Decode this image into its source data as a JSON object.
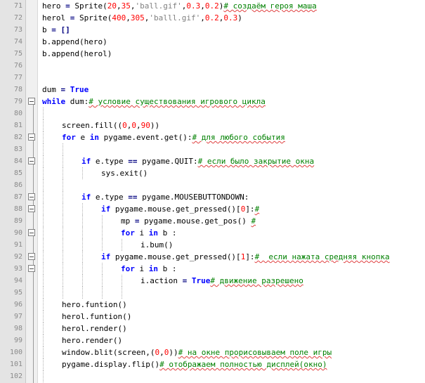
{
  "editor": {
    "lines": [
      {
        "n": "71",
        "indent": 0,
        "tokens": [
          {
            "t": "hero ",
            "c": ""
          },
          {
            "t": "=",
            "c": "op"
          },
          {
            "t": " Sprite(",
            "c": ""
          },
          {
            "t": "20",
            "c": "num"
          },
          {
            "t": ",",
            "c": ""
          },
          {
            "t": "35",
            "c": "num"
          },
          {
            "t": ",",
            "c": ""
          },
          {
            "t": "'ball.gif'",
            "c": "str"
          },
          {
            "t": ",",
            "c": ""
          },
          {
            "t": "0.3",
            "c": "num"
          },
          {
            "t": ",",
            "c": ""
          },
          {
            "t": "0.2",
            "c": "num"
          },
          {
            "t": ")",
            "c": ""
          },
          {
            "t": "# создаём героя маша",
            "c": "cm"
          }
        ]
      },
      {
        "n": "72",
        "indent": 0,
        "tokens": [
          {
            "t": "herol ",
            "c": ""
          },
          {
            "t": "=",
            "c": "op"
          },
          {
            "t": " Sprite(",
            "c": ""
          },
          {
            "t": "400",
            "c": "num"
          },
          {
            "t": ",",
            "c": ""
          },
          {
            "t": "305",
            "c": "num"
          },
          {
            "t": ",",
            "c": ""
          },
          {
            "t": "'balll.gif'",
            "c": "str"
          },
          {
            "t": ",",
            "c": ""
          },
          {
            "t": "0.2",
            "c": "num"
          },
          {
            "t": ",",
            "c": ""
          },
          {
            "t": "0.3",
            "c": "num"
          },
          {
            "t": ")",
            "c": ""
          }
        ]
      },
      {
        "n": "73",
        "indent": 0,
        "tokens": [
          {
            "t": "b ",
            "c": ""
          },
          {
            "t": "=",
            "c": "op"
          },
          {
            "t": " []",
            "c": "op"
          }
        ]
      },
      {
        "n": "74",
        "indent": 0,
        "tokens": [
          {
            "t": "b.append(hero)",
            "c": ""
          }
        ]
      },
      {
        "n": "75",
        "indent": 0,
        "tokens": [
          {
            "t": "b.append(herol)",
            "c": ""
          }
        ]
      },
      {
        "n": "76",
        "indent": 0,
        "tokens": []
      },
      {
        "n": "77",
        "indent": 0,
        "tokens": []
      },
      {
        "n": "78",
        "indent": 0,
        "tokens": [
          {
            "t": "dum ",
            "c": ""
          },
          {
            "t": "=",
            "c": "op"
          },
          {
            "t": " ",
            "c": ""
          },
          {
            "t": "True",
            "c": "kw"
          }
        ]
      },
      {
        "n": "79",
        "indent": 0,
        "fold": true,
        "tokens": [
          {
            "t": "while",
            "c": "kw"
          },
          {
            "t": " dum:",
            "c": ""
          },
          {
            "t": "# условие существования игрового цикла",
            "c": "cm"
          }
        ]
      },
      {
        "n": "80",
        "indent": 1,
        "tokens": []
      },
      {
        "n": "81",
        "indent": 1,
        "tokens": [
          {
            "t": "screen.fill((",
            "c": ""
          },
          {
            "t": "0",
            "c": "num"
          },
          {
            "t": ",",
            "c": ""
          },
          {
            "t": "0",
            "c": "num"
          },
          {
            "t": ",",
            "c": ""
          },
          {
            "t": "90",
            "c": "num"
          },
          {
            "t": "))",
            "c": ""
          }
        ]
      },
      {
        "n": "82",
        "indent": 1,
        "fold": true,
        "tokens": [
          {
            "t": "for",
            "c": "kw"
          },
          {
            "t": " e ",
            "c": ""
          },
          {
            "t": "in",
            "c": "kw"
          },
          {
            "t": " pygame.event.get():",
            "c": ""
          },
          {
            "t": "# для любого события",
            "c": "cm"
          }
        ]
      },
      {
        "n": "83",
        "indent": 2,
        "tokens": []
      },
      {
        "n": "84",
        "indent": 2,
        "fold": true,
        "tokens": [
          {
            "t": "if",
            "c": "kw"
          },
          {
            "t": " e.type ",
            "c": ""
          },
          {
            "t": "==",
            "c": "op"
          },
          {
            "t": " pygame.QUIT:",
            "c": ""
          },
          {
            "t": "# если было закрытие окна",
            "c": "cm"
          }
        ]
      },
      {
        "n": "85",
        "indent": 3,
        "tokens": [
          {
            "t": "sys.exit()",
            "c": ""
          }
        ]
      },
      {
        "n": "86",
        "indent": 2,
        "tokens": []
      },
      {
        "n": "87",
        "indent": 2,
        "fold": true,
        "tokens": [
          {
            "t": "if",
            "c": "kw"
          },
          {
            "t": " e.type ",
            "c": ""
          },
          {
            "t": "==",
            "c": "op"
          },
          {
            "t": " pygame.MOUSEBUTTONDOWN:",
            "c": ""
          }
        ]
      },
      {
        "n": "88",
        "indent": 3,
        "fold": true,
        "tokens": [
          {
            "t": "if",
            "c": "kw"
          },
          {
            "t": " pygame.mouse.get_pressed()[",
            "c": ""
          },
          {
            "t": "0",
            "c": "num"
          },
          {
            "t": "]:",
            "c": ""
          },
          {
            "t": "#",
            "c": "cm"
          }
        ]
      },
      {
        "n": "89",
        "indent": 4,
        "tokens": [
          {
            "t": "mp ",
            "c": ""
          },
          {
            "t": "=",
            "c": "op"
          },
          {
            "t": " pygame.mouse.get_pos() ",
            "c": ""
          },
          {
            "t": "#",
            "c": "cm"
          }
        ]
      },
      {
        "n": "90",
        "indent": 4,
        "fold": true,
        "tokens": [
          {
            "t": "for",
            "c": "kw"
          },
          {
            "t": " i ",
            "c": ""
          },
          {
            "t": "in",
            "c": "kw"
          },
          {
            "t": " b :",
            "c": ""
          }
        ]
      },
      {
        "n": "91",
        "indent": 5,
        "tokens": [
          {
            "t": "i.bum()",
            "c": ""
          }
        ]
      },
      {
        "n": "92",
        "indent": 3,
        "fold": true,
        "tokens": [
          {
            "t": "if",
            "c": "kw"
          },
          {
            "t": " pygame.mouse.get_pressed()[",
            "c": ""
          },
          {
            "t": "1",
            "c": "num"
          },
          {
            "t": "]:",
            "c": ""
          },
          {
            "t": "#  если нажата средняя кнопка",
            "c": "cm"
          }
        ]
      },
      {
        "n": "93",
        "indent": 4,
        "fold": true,
        "tokens": [
          {
            "t": "for",
            "c": "kw"
          },
          {
            "t": " i ",
            "c": ""
          },
          {
            "t": "in",
            "c": "kw"
          },
          {
            "t": " b :",
            "c": ""
          }
        ]
      },
      {
        "n": "94",
        "indent": 5,
        "tokens": [
          {
            "t": "i.action ",
            "c": ""
          },
          {
            "t": "=",
            "c": "op"
          },
          {
            "t": " ",
            "c": ""
          },
          {
            "t": "True",
            "c": "kw"
          },
          {
            "t": "# движение разрешено",
            "c": "cm"
          }
        ]
      },
      {
        "n": "95",
        "indent": 5,
        "tokens": []
      },
      {
        "n": "96",
        "indent": 1,
        "tokens": [
          {
            "t": "hero.funtion()",
            "c": ""
          }
        ]
      },
      {
        "n": "97",
        "indent": 1,
        "tokens": [
          {
            "t": "herol.funtion()",
            "c": ""
          }
        ]
      },
      {
        "n": "98",
        "indent": 1,
        "tokens": [
          {
            "t": "herol.render()",
            "c": ""
          }
        ]
      },
      {
        "n": "99",
        "indent": 1,
        "tokens": [
          {
            "t": "hero.render()",
            "c": ""
          }
        ]
      },
      {
        "n": "100",
        "indent": 1,
        "tokens": [
          {
            "t": "window.blit(screen,(",
            "c": ""
          },
          {
            "t": "0",
            "c": "num"
          },
          {
            "t": ",",
            "c": ""
          },
          {
            "t": "0",
            "c": "num"
          },
          {
            "t": "))",
            "c": ""
          },
          {
            "t": "# на окне прорисовываем поле игры",
            "c": "cm"
          }
        ]
      },
      {
        "n": "101",
        "indent": 1,
        "tokens": [
          {
            "t": "pygame.display.flip()",
            "c": ""
          },
          {
            "t": "# отображаем полностью дисплей(окно)",
            "c": "cm"
          }
        ]
      },
      {
        "n": "102",
        "indent": 1,
        "tokens": []
      }
    ]
  }
}
